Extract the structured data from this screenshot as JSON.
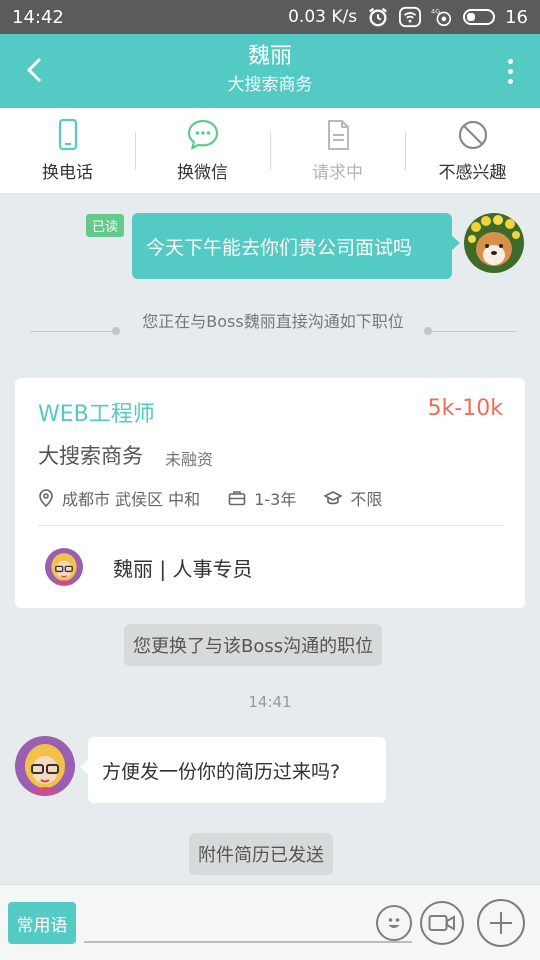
{
  "status_bar": {
    "time": "14:42",
    "speed": "0.03 K/s",
    "network": "4G",
    "battery": "16"
  },
  "header": {
    "name": "魏丽",
    "company": "大搜索商务",
    "back_icon": "chevron-left-icon",
    "more_icon": "more-vertical-icon"
  },
  "actions": [
    {
      "label": "换电话",
      "icon": "phone-icon",
      "enabled": true
    },
    {
      "label": "换微信",
      "icon": "wechat-icon",
      "enabled": true
    },
    {
      "label": "请求中",
      "icon": "document-icon",
      "enabled": false
    },
    {
      "label": "不感兴趣",
      "icon": "ban-icon",
      "enabled": true
    }
  ],
  "chat": {
    "my_message": {
      "read_tag": "已读",
      "text": "今天下午能去你们贵公司面试吗"
    },
    "notice": "您正在与Boss魏丽直接沟通如下职位",
    "job_card": {
      "title": "WEB工程师",
      "salary": "5k-10k",
      "company": "大搜索商务",
      "stage": "未融资",
      "location": "成都市 武侯区 中和",
      "experience": "1-3年",
      "education": "不限",
      "boss": "魏丽 | 人事专员"
    },
    "switch_notice": "您更换了与该Boss沟通的职位",
    "timestamp": "14:41",
    "their_message": "方便发一份你的简历过来吗?",
    "resume_notice": "附件简历已发送"
  },
  "input_bar": {
    "quick_phrases": "常用语",
    "input_value": "",
    "input_placeholder": ""
  },
  "colors": {
    "accent": "#53cac3",
    "salary": "#f26b54",
    "read_tag": "#64c98a"
  }
}
